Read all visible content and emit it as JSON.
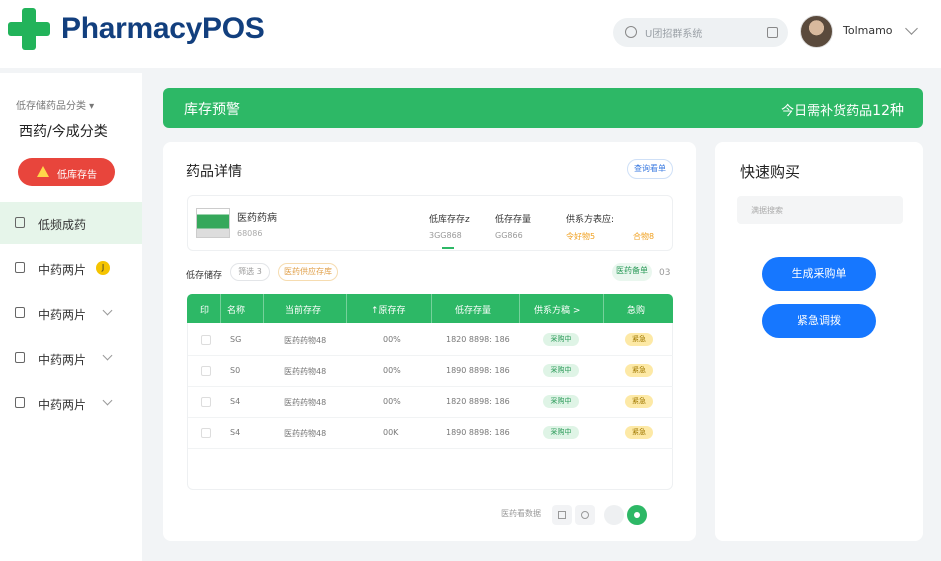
{
  "header": {
    "brand": "PharmacyPOS",
    "search_placeholder": "U团招群系统",
    "user_name": "Tolmamo",
    "brand_color": "#123f7e",
    "accent_color": "#22b35a",
    "icons": [
      "plus-cross-logo",
      "search-icon",
      "clear-icon",
      "avatar",
      "chevron-down-icon"
    ]
  },
  "sidebar": {
    "category_label": "低存储药品分类",
    "category_title": "西药/今成分类",
    "alert_button": "低库存告",
    "items": [
      {
        "label": "低频成药",
        "active": true,
        "badge": ""
      },
      {
        "label": "中药两片",
        "active": false,
        "badge": "J"
      },
      {
        "label": "中药两片",
        "active": false,
        "badge": ""
      },
      {
        "label": "中药两片",
        "active": false,
        "badge": ""
      },
      {
        "label": "中药两片",
        "active": false,
        "badge": ""
      }
    ]
  },
  "banner": {
    "title": "库存预警",
    "right_text": "今日需补货药品",
    "count": "12种",
    "color": "#2db866"
  },
  "main": {
    "title": "药品详情",
    "more_button": "查询看单",
    "detail": {
      "name": "医药药病",
      "code": "68086",
      "columns": [
        {
          "head": "低库存存z",
          "value": "3GG868",
          "color": "#999999"
        },
        {
          "head": "低存存量",
          "value": "GG866",
          "color": "#999999"
        },
        {
          "head": "供系方表应:",
          "value": "令好物5",
          "color": "#f0a020"
        },
        {
          "head": "",
          "value": "合物8",
          "color": "#f0a020"
        }
      ]
    },
    "filter": {
      "label": "低存储存",
      "pill1": "筛选 3",
      "pill2": "医药供应存库",
      "right_label": "医药备单",
      "right_count": "03"
    },
    "table": {
      "headers": [
        "印",
        "名称",
        "当前存存",
        "↑原存存",
        "低存存量",
        "供系方稿 >",
        "急购"
      ],
      "rows": [
        {
          "name": "SG",
          "current": "医药药物48",
          "original": "00%",
          "low": "1820 8898: 186",
          "supplier": "采购中",
          "status": "紧急"
        },
        {
          "name": "S0",
          "current": "医药药物48",
          "original": "00%",
          "low": "1890 8898: 186",
          "supplier": "采购中",
          "status": "紧急"
        },
        {
          "name": "S4",
          "current": "医药药物48",
          "original": "00%",
          "low": "1820 8898: 186",
          "supplier": "采购中",
          "status": "紧急"
        },
        {
          "name": "S4",
          "current": "医药药物48",
          "original": "00K",
          "low": "1890 8898: 186",
          "supplier": "采购中",
          "status": "紧急"
        }
      ]
    },
    "pagination": {
      "label": "医药看数据"
    }
  },
  "quick": {
    "title": "快速购买",
    "input_placeholder": "满据搜索",
    "button1": "生成采购单",
    "button2": "紧急调拨",
    "button_color": "#1677ff"
  }
}
